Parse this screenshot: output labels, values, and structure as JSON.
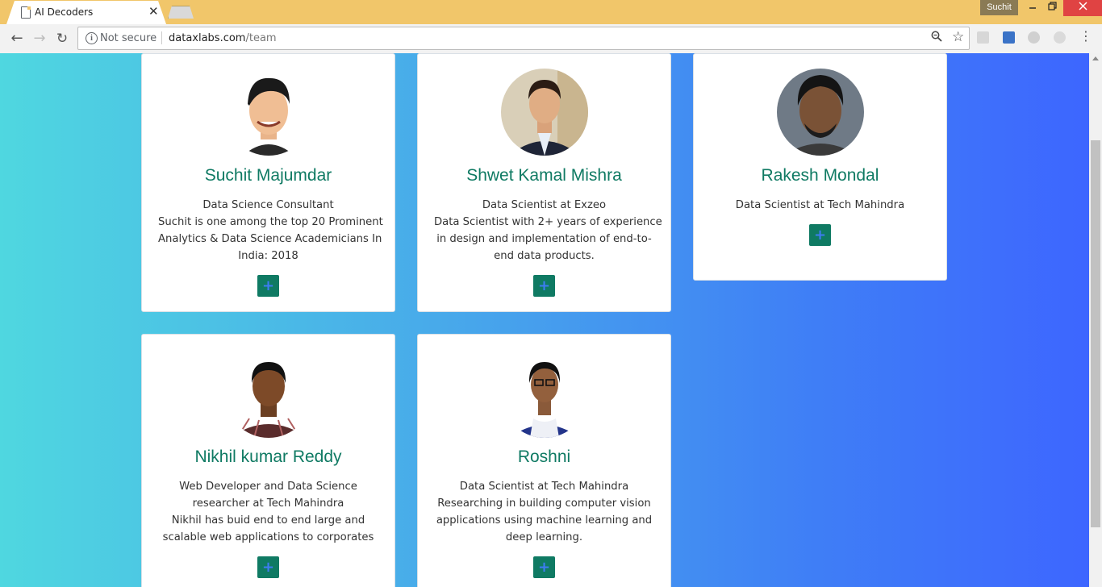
{
  "browser": {
    "tab_title": "AI Decoders",
    "tab_close": "✕",
    "user_name": "Suchit",
    "window_controls": {
      "minimize": "🗕",
      "maximize": "🗗",
      "close": "✕"
    },
    "nav": {
      "back": "←",
      "forward": "→",
      "reload": "↻"
    },
    "security_label": "Not secure",
    "url_host": "dataxlabs.com",
    "url_path": "/team",
    "icons": [
      "info-icon",
      "zoom-icon",
      "star-icon",
      "pdf-extension-icon",
      "reader-extension-icon",
      "circle-extension-icon",
      "grey-extension-icon",
      "menu-icon"
    ]
  },
  "team": [
    {
      "name": "Suchit Majumdar",
      "lines": [
        "Data Science Consultant",
        "Suchit is one among the top 20 Prominent",
        "Analytics & Data Science Academicians In",
        "India: 2018"
      ],
      "button": "+"
    },
    {
      "name": "Shwet Kamal Mishra",
      "lines": [
        "Data Scientist at Exzeo",
        "Data Scientist with 2+ years of experience",
        "in design and implementation of end-to-",
        "end data products."
      ],
      "button": "+"
    },
    {
      "name": "Rakesh Mondal",
      "lines": [
        "Data Scientist at Tech Mahindra"
      ],
      "button": "+"
    },
    {
      "name": "Nikhil kumar Reddy",
      "lines": [
        "Web Developer and Data Science",
        "researcher at Tech Mahindra",
        "Nikhil has buid end to end large and",
        "scalable web applications to corporates"
      ],
      "button": "+"
    },
    {
      "name": "Roshni",
      "lines": [
        "Data Scientist at Tech Mahindra",
        "Researching in building computer vision",
        "applications using machine learning and",
        "deep learning."
      ],
      "button": "+"
    }
  ],
  "colors": {
    "accent_green": "#0f7a63",
    "plus_icon_blue": "#3e7cf2",
    "titlebar": "#f1c66a",
    "gradient_start": "#4fd7e0",
    "gradient_end": "#3d66ff"
  }
}
